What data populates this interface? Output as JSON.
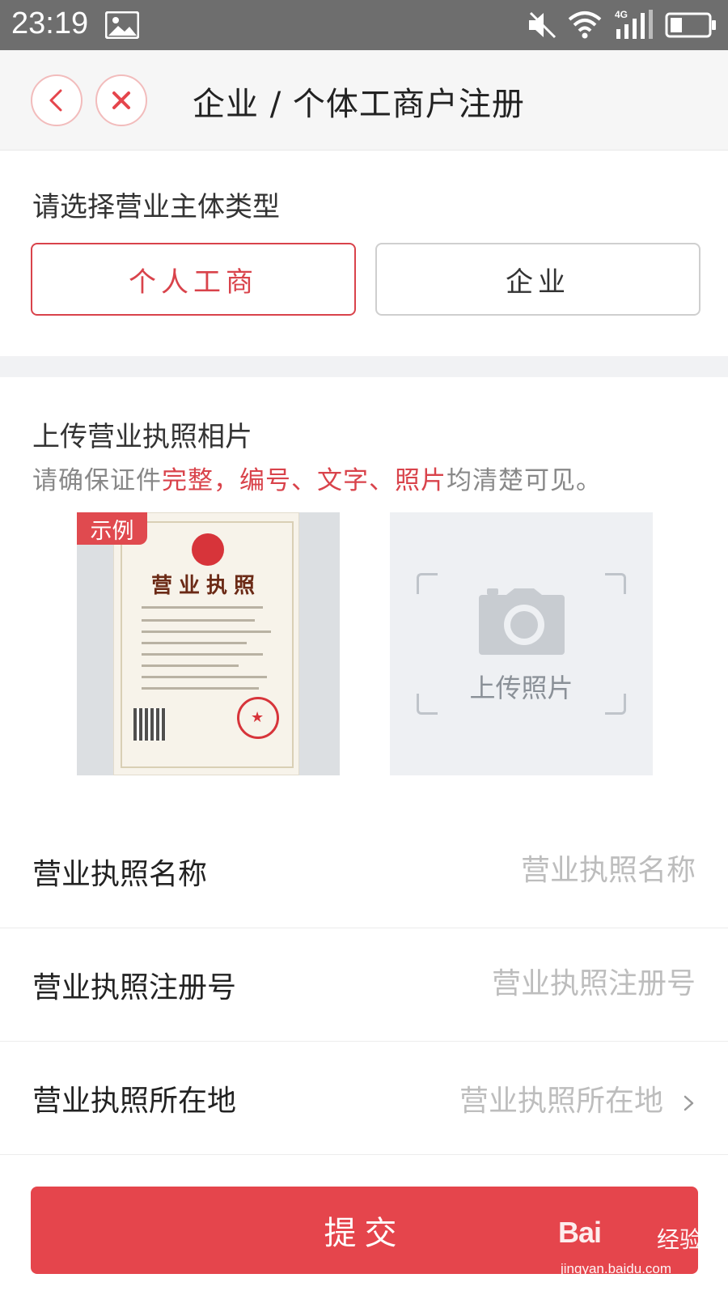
{
  "status_bar": {
    "time": "23:19",
    "icons": [
      "image-icon",
      "mute-icon",
      "wifi-icon",
      "signal-4g-icon",
      "battery-icon"
    ],
    "network_label": "4G"
  },
  "header": {
    "title": "企业 / 个体工商户注册",
    "back_icon": "chevron-left-icon",
    "close_icon": "close-icon"
  },
  "entity_type": {
    "label": "请选择营业主体类型",
    "options": [
      {
        "label": "个人工商",
        "selected": true
      },
      {
        "label": "企业",
        "selected": false
      }
    ]
  },
  "license_upload": {
    "title": "上传营业执照相片",
    "hint": {
      "p1": "请确保证件",
      "p2": "完整，编号、文字、照片",
      "p3": "均清楚可见。"
    },
    "example_badge": "示例",
    "example_cert_title": "营业执照",
    "upload_label": "上传照片"
  },
  "form": {
    "fields": [
      {
        "label": "营业执照名称",
        "placeholder": "营业执照名称"
      },
      {
        "label": "营业执照注册号",
        "placeholder": "营业执照注册号"
      },
      {
        "label": "营业执照所在地",
        "placeholder": "营业执照所在地"
      }
    ]
  },
  "submit": {
    "label": "提交"
  },
  "watermark": {
    "logo": "Bai",
    "cn": "经验",
    "url": "jingyan.baidu.com"
  },
  "colors": {
    "accent": "#e5454c",
    "accent_text": "#d9434b",
    "status_bar": "#6e6e6e",
    "band": "#f1f2f4"
  }
}
